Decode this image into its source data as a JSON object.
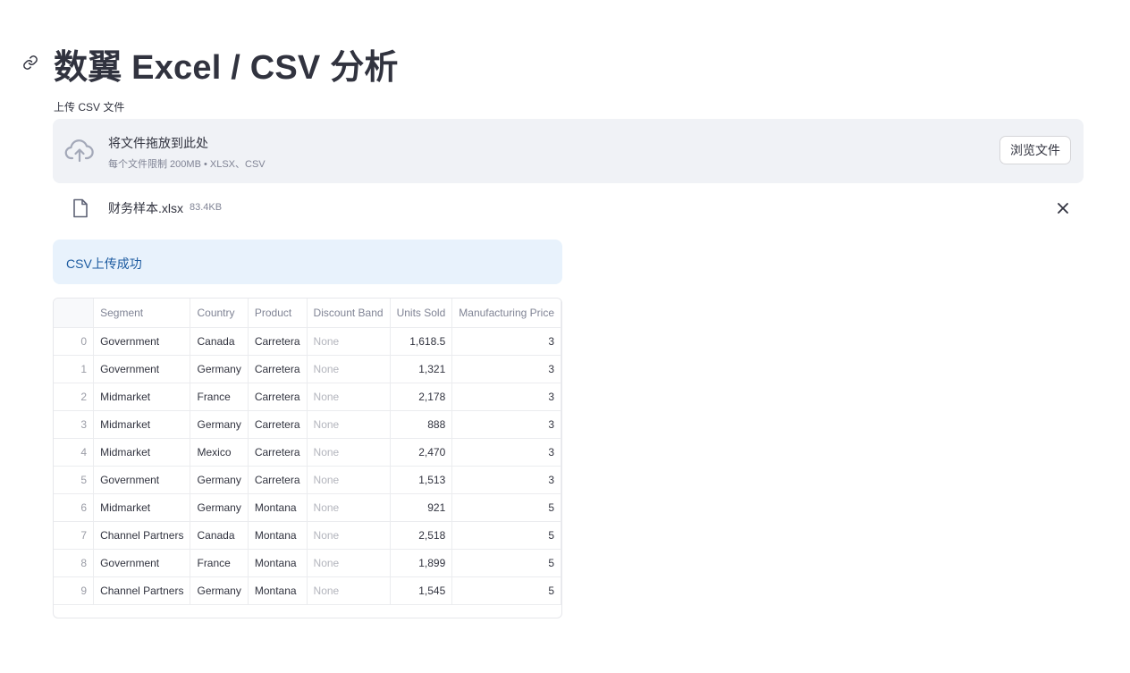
{
  "page": {
    "title": "数翼 Excel / CSV 分析",
    "anchor_icon": "link-icon"
  },
  "uploader": {
    "label": "上传 CSV 文件",
    "dropzone_instruction": "将文件拖放到此处",
    "dropzone_limits": "每个文件限制 200MB • XLSX、CSV",
    "browse_label": "浏览文件",
    "icons": {
      "upload": "cloud-upload-icon",
      "file": "file-icon",
      "remove": "close-icon"
    },
    "file": {
      "name": "财务样本.xlsx",
      "size": "83.4KB"
    }
  },
  "alert": {
    "text": "CSV上传成功",
    "color": "#1c5ba0",
    "background": "#e8f2fc"
  },
  "table": {
    "columns": [
      "",
      "Segment",
      "Country",
      "Product",
      "Discount Band",
      "Units Sold",
      "Manufacturing Price"
    ],
    "rows": [
      [
        "0",
        "Government",
        "Canada",
        "Carretera",
        "None",
        "1,618.5",
        "3"
      ],
      [
        "1",
        "Government",
        "Germany",
        "Carretera",
        "None",
        "1,321",
        "3"
      ],
      [
        "2",
        "Midmarket",
        "France",
        "Carretera",
        "None",
        "2,178",
        "3"
      ],
      [
        "3",
        "Midmarket",
        "Germany",
        "Carretera",
        "None",
        "888",
        "3"
      ],
      [
        "4",
        "Midmarket",
        "Mexico",
        "Carretera",
        "None",
        "2,470",
        "3"
      ],
      [
        "5",
        "Government",
        "Germany",
        "Carretera",
        "None",
        "1,513",
        "3"
      ],
      [
        "6",
        "Midmarket",
        "Germany",
        "Montana",
        "None",
        "921",
        "5"
      ],
      [
        "7",
        "Channel Partners",
        "Canada",
        "Montana",
        "None",
        "2,518",
        "5"
      ],
      [
        "8",
        "Government",
        "France",
        "Montana",
        "None",
        "1,899",
        "5"
      ],
      [
        "9",
        "Channel Partners",
        "Germany",
        "Montana",
        "None",
        "1,545",
        "5"
      ]
    ]
  }
}
